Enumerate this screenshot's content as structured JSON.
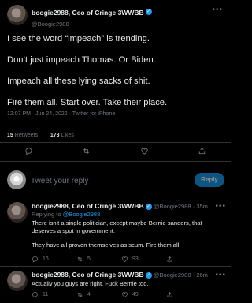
{
  "tweet": {
    "author_name": "boogie2988, Ceo of Cringe 3WWBB",
    "author_handle": "@Boogie2988",
    "paragraphs": [
      "I see the word “impeach” is trending.",
      "Don’t just impeach Thomas. Or Biden.",
      "Impeach all these lying sacks of shit.",
      "Fire them all. Start over. Take their place."
    ],
    "meta": "12:07 PM · Jun 24, 2022 · Twitter for iPhone",
    "retweets_count": "15",
    "retweets_label": "Retweets",
    "likes_count": "173",
    "likes_label": "Likes"
  },
  "reply_box": {
    "placeholder": "Tweet your reply",
    "button_label": "Reply"
  },
  "replies": [
    {
      "author_name": "boogie2988, Ceo of Cringe 3WWBB",
      "author_handle": "@Boogie2988",
      "time": "35m",
      "replying_prefix": "Replying to",
      "replying_handle": "@Boogie2988",
      "paragraphs": [
        "There isn't a single politician, except maybe Bernie sanders, that deserves a spot in government.",
        "They have all proven themselves as scum. Fire them all."
      ],
      "replies_count": "16",
      "retweets_count": "5",
      "likes_count": "93"
    },
    {
      "author_name": "boogie2988, Ceo of Cringe 3WWBB",
      "author_handle": "@Boogie2988",
      "time": "26m",
      "paragraphs": [
        "Actually you guys are right. Fuck Bernie too."
      ],
      "replies_count": "11",
      "retweets_count": "4",
      "likes_count": "49"
    }
  ],
  "colors": {
    "background": "#000000",
    "text": "#e7e9ea",
    "secondary_text": "#71767b",
    "accent": "#1d9bf0",
    "divider": "#2f3336"
  },
  "icons": [
    "verified-badge-icon",
    "more-icon",
    "reply-icon",
    "retweet-icon",
    "like-icon",
    "share-icon"
  ]
}
